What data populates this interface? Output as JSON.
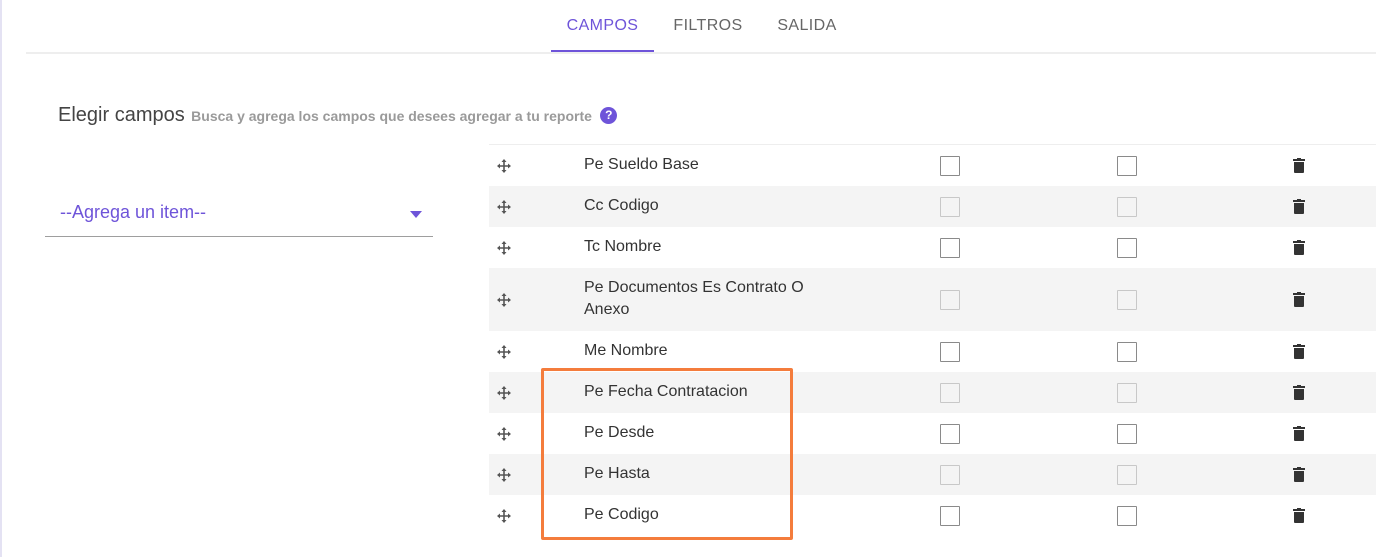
{
  "tabs": [
    {
      "label": "CAMPOS",
      "active": true
    },
    {
      "label": "FILTROS",
      "active": false
    },
    {
      "label": "SALIDA",
      "active": false
    }
  ],
  "section": {
    "title": "Elegir campos",
    "hint": "Busca y agrega los campos que desees agregar a tu reporte",
    "help_icon": "?"
  },
  "select": {
    "placeholder": "--Agrega un item--",
    "icon": "caret-down-icon"
  },
  "fields": [
    {
      "name": "Pe Sueldo Base",
      "checked_1": false,
      "checked_2": false
    },
    {
      "name": "Cc Codigo",
      "checked_1": false,
      "checked_2": false
    },
    {
      "name": "Tc Nombre",
      "checked_1": false,
      "checked_2": false
    },
    {
      "name": "Pe Documentos Es Contrato O Anexo",
      "checked_1": false,
      "checked_2": false
    },
    {
      "name": "Me Nombre",
      "checked_1": false,
      "checked_2": false
    },
    {
      "name": "Pe Fecha Contratacion",
      "checked_1": false,
      "checked_2": false
    },
    {
      "name": "Pe Desde",
      "checked_1": false,
      "checked_2": false
    },
    {
      "name": "Pe Hasta",
      "checked_1": false,
      "checked_2": false
    },
    {
      "name": "Pe Codigo",
      "checked_1": false,
      "checked_2": false
    }
  ],
  "colors": {
    "accent": "#6e54d9",
    "highlight": "#f47c3c",
    "row_shade": "#f4f4f4"
  }
}
